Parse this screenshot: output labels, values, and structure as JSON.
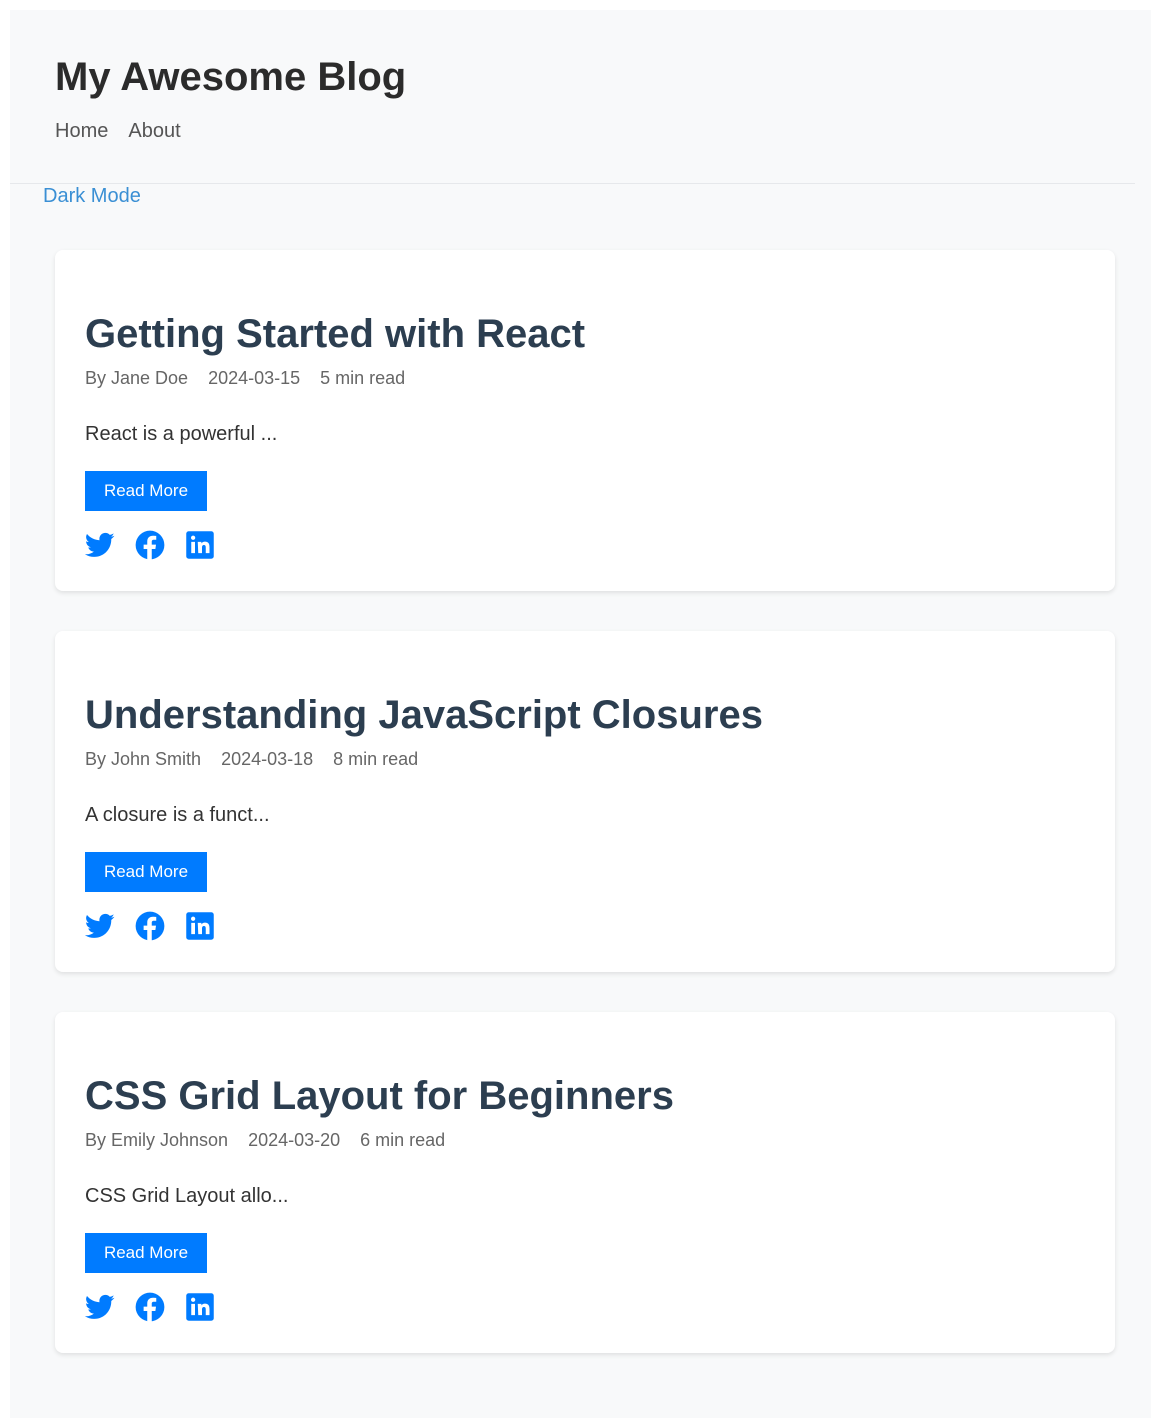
{
  "site": {
    "title": "My Awesome Blog",
    "nav": [
      {
        "label": "Home"
      },
      {
        "label": "About"
      }
    ],
    "dark_mode_label": "Dark Mode"
  },
  "posts": [
    {
      "title": "Getting Started with React",
      "author": "By Jane Doe",
      "date": "2024-03-15",
      "read_time": "5 min read",
      "excerpt": "React is a powerful ...",
      "read_more_label": "Read More"
    },
    {
      "title": "Understanding JavaScript Closures",
      "author": "By John Smith",
      "date": "2024-03-18",
      "read_time": "8 min read",
      "excerpt": "A closure is a funct...",
      "read_more_label": "Read More"
    },
    {
      "title": "CSS Grid Layout for Beginners",
      "author": "By Emily Johnson",
      "date": "2024-03-20",
      "read_time": "6 min read",
      "excerpt": "CSS Grid Layout allo...",
      "read_more_label": "Read More"
    }
  ],
  "social_icons": [
    "twitter-icon",
    "facebook-icon",
    "linkedin-icon"
  ],
  "colors": {
    "accent": "#007bff",
    "dark_mode_link": "#3a8fd4",
    "post_title": "#2c3e50",
    "page_background": "#f8f9fa"
  }
}
